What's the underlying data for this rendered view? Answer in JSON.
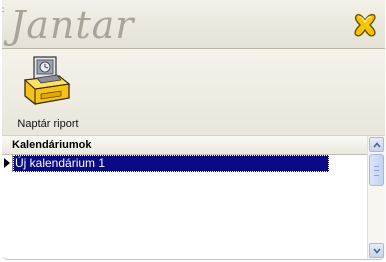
{
  "app": {
    "corner_mark": ":",
    "logo_text": "Jantar"
  },
  "header": {
    "close_icon": "close-x-icon",
    "accent_color": "#f2b300"
  },
  "toolbar": {
    "buttons": [
      {
        "label": "Naptár riport",
        "icon": "calendar-report-printer-icon"
      }
    ]
  },
  "list": {
    "column_header": "Kalendáriumok",
    "rows": [
      {
        "label": "Új kalendárium 1",
        "selected": true
      }
    ],
    "selection_color": "#0a0a84"
  },
  "scrollbar": {
    "up_icon": "scroll-up-arrow-icon",
    "down_icon": "scroll-down-arrow-icon"
  }
}
